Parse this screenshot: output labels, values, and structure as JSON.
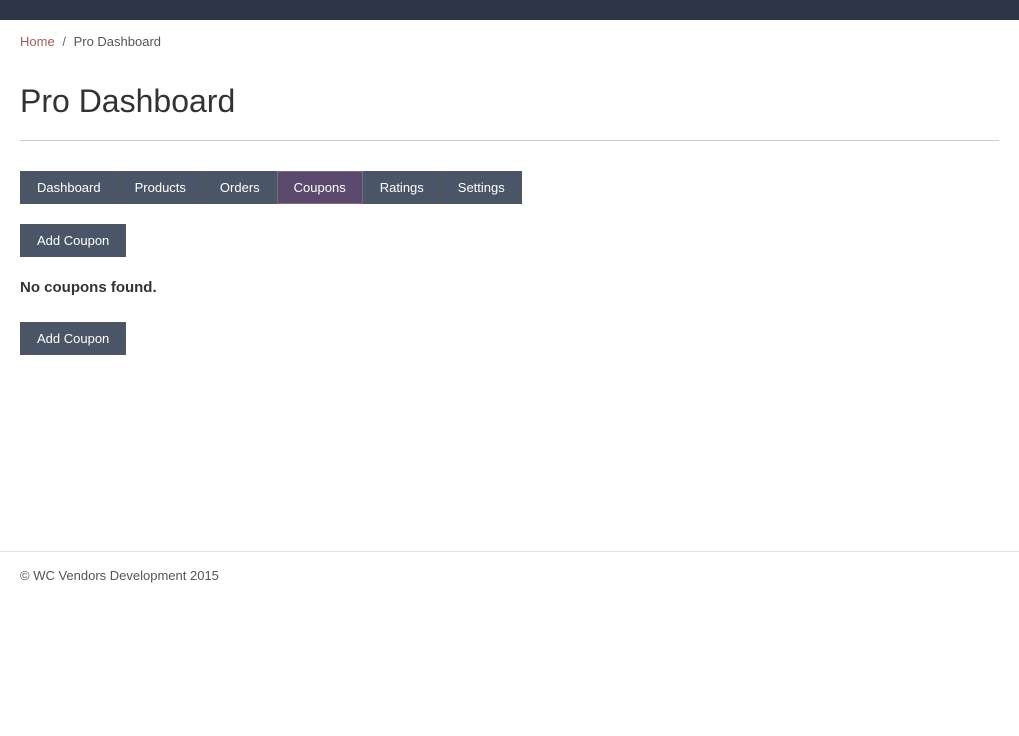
{
  "topbar": {},
  "breadcrumb": {
    "home_label": "Home",
    "home_href": "#",
    "separator": "/",
    "current": "Pro Dashboard"
  },
  "page": {
    "title": "Pro Dashboard"
  },
  "tabs": [
    {
      "label": "Dashboard",
      "active": false
    },
    {
      "label": "Products",
      "active": false
    },
    {
      "label": "Orders",
      "active": false
    },
    {
      "label": "Coupons",
      "active": true
    },
    {
      "label": "Ratings",
      "active": false
    },
    {
      "label": "Settings",
      "active": false
    }
  ],
  "content": {
    "add_coupon_button_top": "Add Coupon",
    "no_coupons_message": "No coupons found.",
    "add_coupon_button_bottom": "Add Coupon"
  },
  "footer": {
    "text": "© WC Vendors Development 2015"
  }
}
